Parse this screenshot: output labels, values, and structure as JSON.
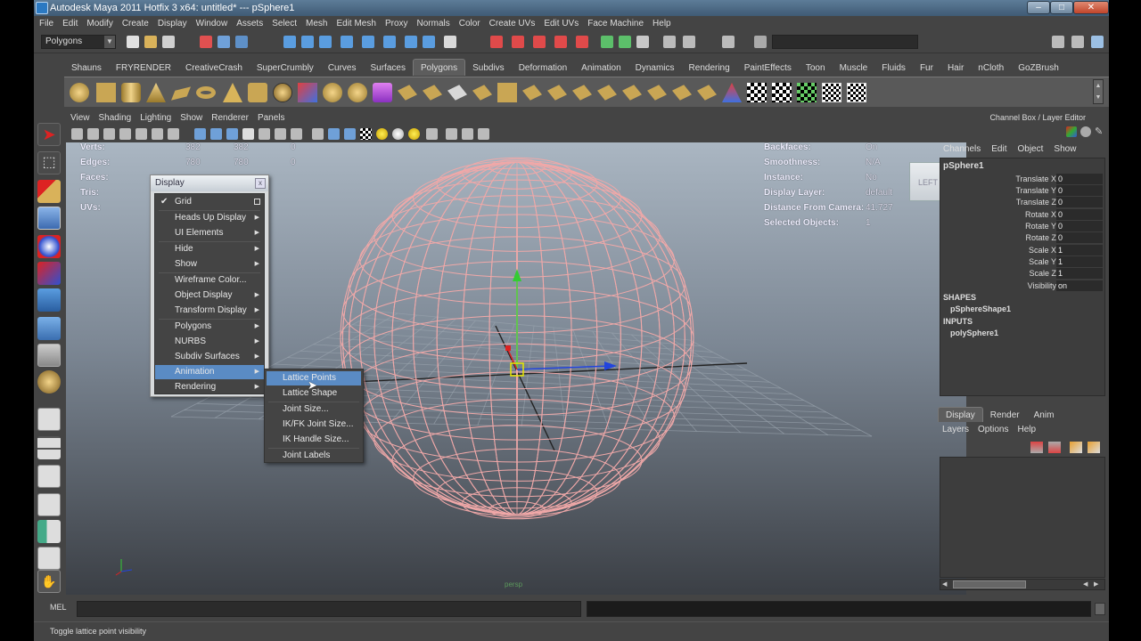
{
  "window": {
    "title": "Autodesk Maya 2011 Hotfix 3 x64: untitled*   ---   pSphere1",
    "minimize": "–",
    "maximize": "□",
    "close": "✕"
  },
  "menubar": [
    "File",
    "Edit",
    "Modify",
    "Create",
    "Display",
    "Window",
    "Assets",
    "Select",
    "Mesh",
    "Edit Mesh",
    "Proxy",
    "Normals",
    "Color",
    "Create UVs",
    "Edit UVs",
    "Face Machine",
    "Help"
  ],
  "statusline": {
    "mode": "Polygons"
  },
  "shelf": {
    "tabs": [
      "Shauns",
      "FRYRENDER",
      "CreativeCrash",
      "SuperCrumbly",
      "Curves",
      "Surfaces",
      "Polygons",
      "Subdivs",
      "Deformation",
      "Animation",
      "Dynamics",
      "Rendering",
      "PaintEffects",
      "Toon",
      "Muscle",
      "Fluids",
      "Fur",
      "Hair",
      "nCloth",
      "GoZBrush"
    ],
    "active_tab": "Polygons"
  },
  "panel": {
    "menu": [
      "View",
      "Shading",
      "Lighting",
      "Show",
      "Renderer",
      "Panels"
    ]
  },
  "hud": {
    "left": [
      {
        "label": "Verts:",
        "a": "382",
        "b": "382",
        "c": "0"
      },
      {
        "label": "Edges:",
        "a": "780",
        "b": "780",
        "c": "0"
      },
      {
        "label": "Faces:",
        "a": "",
        "b": "",
        "c": ""
      },
      {
        "label": "Tris:",
        "a": "",
        "b": "",
        "c": ""
      },
      {
        "label": "UVs:",
        "a": "",
        "b": "",
        "c": ""
      }
    ],
    "right": [
      {
        "label": "Backfaces:",
        "value": "On"
      },
      {
        "label": "Smoothness:",
        "value": "N/A"
      },
      {
        "label": "Instance:",
        "value": "No"
      },
      {
        "label": "Display Layer:",
        "value": "default"
      },
      {
        "label": "Distance From Camera:",
        "value": "41.727"
      },
      {
        "label": "Selected Objects:",
        "value": "1"
      }
    ],
    "viewcube_label": "LEFT",
    "camera_name": "persp"
  },
  "display_menu": {
    "title": "Display",
    "close": "x",
    "items": [
      {
        "label": "Grid",
        "checked": true,
        "option_box": true
      },
      {
        "label": "Heads Up Display",
        "submenu": true
      },
      {
        "label": "UI Elements",
        "submenu": true
      },
      {
        "label": "Hide",
        "submenu": true
      },
      {
        "label": "Show",
        "submenu": true
      },
      {
        "label": "Wireframe Color...",
        "submenu": false
      },
      {
        "label": "Object Display",
        "submenu": true
      },
      {
        "label": "Transform Display",
        "submenu": true
      },
      {
        "label": "Polygons",
        "submenu": true
      },
      {
        "label": "NURBS",
        "submenu": true
      },
      {
        "label": "Subdiv Surfaces",
        "submenu": true
      },
      {
        "label": "Animation",
        "submenu": true,
        "highlighted": true
      },
      {
        "label": "Rendering",
        "submenu": true
      }
    ]
  },
  "animation_submenu": {
    "items": [
      {
        "label": "Lattice Points",
        "highlighted": true
      },
      {
        "label": "Lattice Shape"
      },
      {
        "label": "Joint Size..."
      },
      {
        "label": "IK/FK Joint Size..."
      },
      {
        "label": "IK Handle Size..."
      },
      {
        "label": "Joint Labels"
      }
    ]
  },
  "channel_box": {
    "title": "Channel Box / Layer Editor",
    "menu": [
      "Channels",
      "Edit",
      "Object",
      "Show"
    ],
    "object": "pSphere1",
    "attributes": [
      {
        "name": "Translate X",
        "value": "0"
      },
      {
        "name": "Translate Y",
        "value": "0"
      },
      {
        "name": "Translate Z",
        "value": "0"
      },
      {
        "name": "Rotate X",
        "value": "0"
      },
      {
        "name": "Rotate Y",
        "value": "0"
      },
      {
        "name": "Rotate Z",
        "value": "0"
      },
      {
        "name": "Scale X",
        "value": "1"
      },
      {
        "name": "Scale Y",
        "value": "1"
      },
      {
        "name": "Scale Z",
        "value": "1"
      },
      {
        "name": "Visibility",
        "value": "on"
      }
    ],
    "shapes_label": "SHAPES",
    "shape_node": "pSphereShape1",
    "inputs_label": "INPUTS",
    "input_node": "polySphere1"
  },
  "layer_editor": {
    "tabs": [
      "Display",
      "Render",
      "Anim"
    ],
    "active_tab": "Display",
    "menu": [
      "Layers",
      "Options",
      "Help"
    ]
  },
  "command_line": {
    "label": "MEL"
  },
  "help_line": {
    "text": "Toggle lattice point visibility"
  },
  "colors": {
    "ui_bg": "#444444",
    "wireframe": "#f0a8a8",
    "highlight": "#5a8bc4",
    "axis_y": "#33cc33",
    "axis_x": "#dd2222",
    "axis_z": "#2244dd",
    "manip_center": "#e8e800"
  }
}
